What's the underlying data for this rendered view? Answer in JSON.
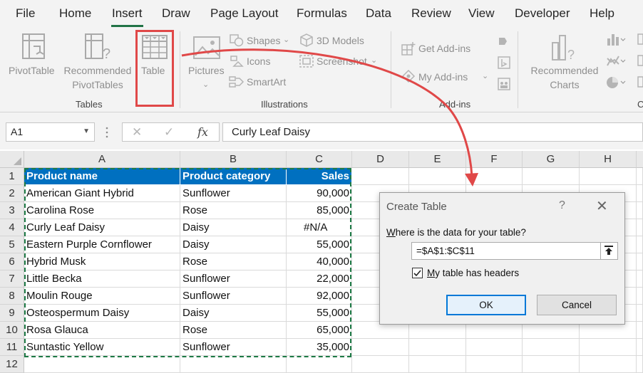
{
  "menu": {
    "tabs": [
      {
        "label": "File"
      },
      {
        "label": "Home"
      },
      {
        "label": "Insert"
      },
      {
        "label": "Draw"
      },
      {
        "label": "Page Layout"
      },
      {
        "label": "Formulas"
      },
      {
        "label": "Data"
      },
      {
        "label": "Review"
      },
      {
        "label": "View"
      },
      {
        "label": "Developer"
      },
      {
        "label": "Help"
      }
    ],
    "active_tab": "Insert"
  },
  "ribbon": {
    "tables": {
      "pivottable": "PivotTable",
      "recommended_1": "Recommended",
      "recommended_2": "PivotTables",
      "table": "Table",
      "group": "Tables"
    },
    "illustrations": {
      "pictures": "Pictures",
      "shapes": "Shapes",
      "icons": "Icons",
      "smartart": "SmartArt",
      "models_3d": "3D Models",
      "screenshot": "Screenshot",
      "group": "Illustrations"
    },
    "addins": {
      "get": "Get Add-ins",
      "my": "My Add-ins",
      "group": "Add-ins"
    },
    "charts": {
      "recommended_1": "Recommended",
      "recommended_2": "Charts",
      "group_partial": "C"
    }
  },
  "formula_bar": {
    "name_box": "A1",
    "fx": "fx",
    "content": "Curly Leaf Daisy"
  },
  "sheet": {
    "columns": [
      "A",
      "B",
      "C",
      "D",
      "E",
      "F",
      "G",
      "H"
    ],
    "rows": [
      "1",
      "2",
      "3",
      "4",
      "5",
      "6",
      "7",
      "8",
      "9",
      "10",
      "11",
      "12"
    ],
    "header": [
      "Product name",
      "Product category",
      "Sales"
    ],
    "data": [
      [
        "American Giant Hybrid",
        "Sunflower",
        "90,000"
      ],
      [
        "Carolina Rose",
        "Rose",
        "85,000"
      ],
      [
        "Curly Leaf Daisy",
        "Daisy",
        "#N/A"
      ],
      [
        "Eastern Purple Cornflower",
        "Daisy",
        "55,000"
      ],
      [
        "Hybrid Musk",
        "Rose",
        "40,000"
      ],
      [
        "Little Becka",
        "Sunflower",
        "22,000"
      ],
      [
        "Moulin Rouge",
        "Sunflower",
        "92,000"
      ],
      [
        "Osteospermum Daisy",
        "Daisy",
        "55,000"
      ],
      [
        "Rosa Glauca",
        "Rose",
        "65,000"
      ],
      [
        "Suntastic Yellow",
        "Sunflower",
        "35,000"
      ]
    ]
  },
  "dialog": {
    "title": "Create Table",
    "help": "?",
    "close": "✕",
    "prompt": "Where is the data for your table?",
    "range": "=$A$1:$C$11",
    "headers_checkbox_label": "My table has headers",
    "headers_checked": true,
    "ok": "OK",
    "cancel": "Cancel"
  },
  "colors": {
    "accent_green": "#217346",
    "header_fill": "#0070c0",
    "highlight_red": "#e04848"
  }
}
